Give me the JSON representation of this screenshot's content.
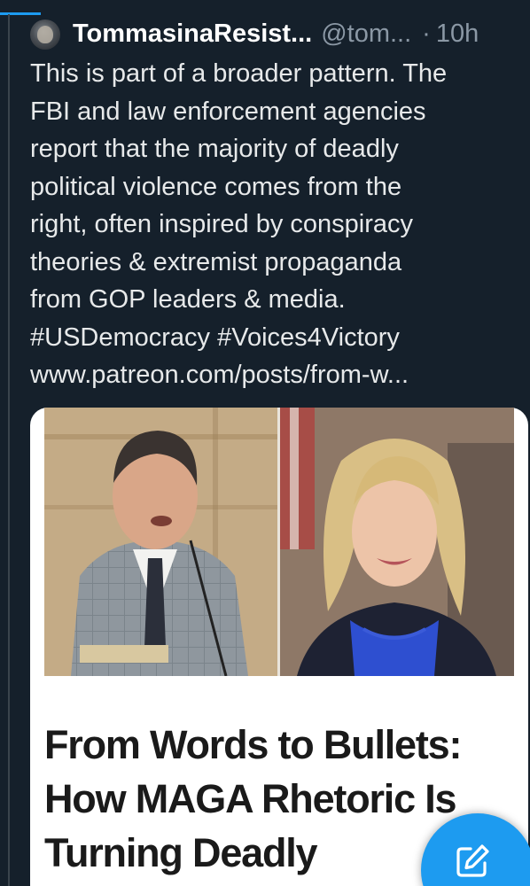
{
  "colors": {
    "background": "#15202b",
    "accent": "#1d9bf0",
    "primary_text": "#e7e9ea",
    "secondary_text": "#8b98a5"
  },
  "tweet": {
    "author_name": "TommasinaResist...",
    "author_handle": "@tom...",
    "separator": "·",
    "time_ago": "10h",
    "body_lines": [
      "This is part of a broader pattern. The",
      "FBI and law enforcement agencies",
      "report that the majority of deadly",
      "political violence comes from the",
      "right, often inspired by conspiracy",
      "theories & extremist propaganda",
      "from GOP leaders & media.",
      "#USDemocracy #Voices4Victory",
      "www.patreon.com/posts/from-w..."
    ]
  },
  "card": {
    "image_alt_left": "man in grey plaid suit speaking at microphone",
    "image_alt_right": "smiling woman with blonde hair and blue necklace",
    "headline_lines": [
      "From Words to Bullets:",
      "How MAGA Rhetoric Is",
      "Turning Deadly"
    ]
  },
  "icons": {
    "compose": "compose-icon"
  }
}
